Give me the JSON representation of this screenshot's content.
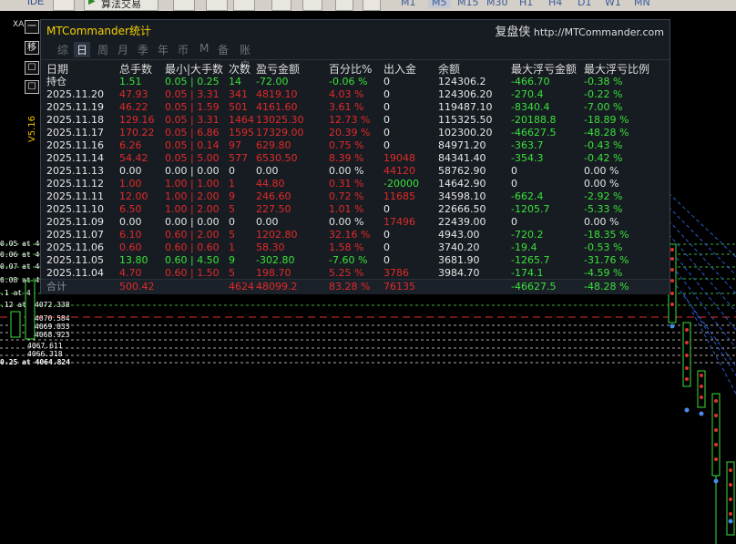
{
  "toolbar": {
    "idle_label": "IDE",
    "algo_label": "算法交易",
    "timeframes": [
      "M1",
      "M5",
      "M15",
      "M30",
      "H1",
      "H4",
      "D1",
      "W1",
      "MN"
    ],
    "active_timeframe": "M5"
  },
  "chart": {
    "symbol": "XA",
    "version": "V5.16",
    "side_buttons": [
      "一",
      "移",
      "☐",
      "☐"
    ],
    "price_labels": [
      {
        "text": "0.05 at 408"
      },
      {
        "text": "0.06 at 407"
      },
      {
        "text": "0.07 at 407"
      },
      {
        "text": "0.08 at 407"
      },
      {
        "text": ".1 at 4 "
      },
      {
        "text": ".12 at "
      },
      {
        "text": "4072.338"
      },
      {
        "text": "4070.584"
      },
      {
        "text": "4069.833"
      },
      {
        "text": "4068.923"
      },
      {
        "text": "4067.611"
      },
      {
        "text": "4066.318"
      },
      {
        "text": "0.25 at 4064.824"
      }
    ]
  },
  "panel": {
    "title": "MTCommander统计",
    "brand": "复盘侠",
    "brand_url": "http://MTCommander.com",
    "tabs": [
      "综",
      "日",
      "周",
      "月",
      "季",
      "年",
      "币",
      "M",
      "备",
      "账户"
    ],
    "active_tab": "日",
    "headers": [
      "日期",
      "总手数",
      "最小|大手数",
      "次数",
      "盈亏金额",
      "百分比%",
      "出入金",
      "余额",
      "最大浮亏金额",
      "最大浮亏比例"
    ],
    "holding": {
      "date": "持仓",
      "lots": "1.51",
      "minmax": "0.05 | 0.25",
      "count": "14",
      "pnl": "-72.00",
      "pct": "-0.06 %",
      "io": "0",
      "balance": "124306.2",
      "maxdd": "-466.70",
      "maxddpct": "-0.38 %"
    },
    "rows": [
      {
        "date": "2025.11.20",
        "lots": "47.93",
        "minmax": "0.05 | 3.31",
        "count": "341",
        "pnl": "4819.10",
        "pct": "4.03 %",
        "io": "0",
        "balance": "124306.20",
        "maxdd": "-270.4",
        "maxddpct": "-0.22 %",
        "color": "red"
      },
      {
        "date": "2025.11.19",
        "lots": "46.22",
        "minmax": "0.05 | 1.59",
        "count": "501",
        "pnl": "4161.60",
        "pct": "3.61 %",
        "io": "0",
        "balance": "119487.10",
        "maxdd": "-8340.4",
        "maxddpct": "-7.00 %",
        "color": "red"
      },
      {
        "date": "2025.11.18",
        "lots": "129.16",
        "minmax": "0.05 | 3.31",
        "count": "1464",
        "pnl": "13025.30",
        "pct": "12.73 %",
        "io": "0",
        "balance": "115325.50",
        "maxdd": "-20188.8",
        "maxddpct": "-18.89 %",
        "color": "red"
      },
      {
        "date": "2025.11.17",
        "lots": "170.22",
        "minmax": "0.05 | 6.86",
        "count": "1595",
        "pnl": "17329.00",
        "pct": "20.39 %",
        "io": "0",
        "balance": "102300.20",
        "maxdd": "-46627.5",
        "maxddpct": "-48.28 %",
        "color": "red"
      },
      {
        "date": "2025.11.16",
        "lots": "6.26",
        "minmax": "0.05 | 0.14",
        "count": "97",
        "pnl": "629.80",
        "pct": "0.75 %",
        "io": "0",
        "balance": "84971.20",
        "maxdd": "-363.7",
        "maxddpct": "-0.43 %",
        "color": "red"
      },
      {
        "date": "2025.11.14",
        "lots": "54.42",
        "minmax": "0.05 | 5.00",
        "count": "577",
        "pnl": "6530.50",
        "pct": "8.39 %",
        "io": "19048",
        "balance": "84341.40",
        "maxdd": "-354.3",
        "maxddpct": "-0.42 %",
        "color": "red"
      },
      {
        "date": "2025.11.13",
        "lots": "0.00",
        "minmax": "0.00 | 0.00",
        "count": "0",
        "pnl": "0.00",
        "pct": "0.00 %",
        "io": "44120",
        "balance": "58762.90",
        "maxdd": "0",
        "maxddpct": "0.00 %",
        "color": "white"
      },
      {
        "date": "2025.11.12",
        "lots": "1.00",
        "minmax": "1.00 | 1.00",
        "count": "1",
        "pnl": "44.80",
        "pct": "0.31 %",
        "io": "-20000",
        "balance": "14642.90",
        "maxdd": "0",
        "maxddpct": "0.00 %",
        "color": "red"
      },
      {
        "date": "2025.11.11",
        "lots": "12.00",
        "minmax": "1.00 | 2.00",
        "count": "9",
        "pnl": "246.60",
        "pct": "0.72 %",
        "io": "11685",
        "balance": "34598.10",
        "maxdd": "-662.4",
        "maxddpct": "-2.92 %",
        "color": "red"
      },
      {
        "date": "2025.11.10",
        "lots": "6.50",
        "minmax": "1.00 | 2.00",
        "count": "5",
        "pnl": "227.50",
        "pct": "1.01 %",
        "io": "0",
        "balance": "22666.50",
        "maxdd": "-1205.7",
        "maxddpct": "-5.33 %",
        "color": "red"
      },
      {
        "date": "2025.11.09",
        "lots": "0.00",
        "minmax": "0.00 | 0.00",
        "count": "0",
        "pnl": "0.00",
        "pct": "0.00 %",
        "io": "17496",
        "balance": "22439.00",
        "maxdd": "0",
        "maxddpct": "0.00 %",
        "color": "white"
      },
      {
        "date": "2025.11.07",
        "lots": "6.10",
        "minmax": "0.60 | 2.00",
        "count": "5",
        "pnl": "1202.80",
        "pct": "32.16 %",
        "io": "0",
        "balance": "4943.00",
        "maxdd": "-720.2",
        "maxddpct": "-18.35 %",
        "color": "red"
      },
      {
        "date": "2025.11.06",
        "lots": "0.60",
        "minmax": "0.60 | 0.60",
        "count": "1",
        "pnl": "58.30",
        "pct": "1.58 %",
        "io": "0",
        "balance": "3740.20",
        "maxdd": "-19.4",
        "maxddpct": "-0.53 %",
        "color": "red"
      },
      {
        "date": "2025.11.05",
        "lots": "13.80",
        "minmax": "0.60 | 4.50",
        "count": "9",
        "pnl": "-302.80",
        "pct": "-7.60 %",
        "io": "0",
        "balance": "3681.90",
        "maxdd": "-1265.7",
        "maxddpct": "-31.76 %",
        "color": "green"
      },
      {
        "date": "2025.11.04",
        "lots": "4.70",
        "minmax": "0.60 | 1.50",
        "count": "5",
        "pnl": "198.70",
        "pct": "5.25 %",
        "io": "3786",
        "balance": "3984.70",
        "maxdd": "-174.1",
        "maxddpct": "-4.59 %",
        "color": "red"
      }
    ],
    "total": {
      "date": "合计",
      "lots": "500.42",
      "minmax": "",
      "count": "4624",
      "pnl": "48099.2",
      "pct": "83.28 %",
      "io": "76135",
      "balance": "",
      "maxdd": "-46627.5",
      "maxddpct": "-48.28 %"
    },
    "colors": {
      "profit": "#e02a2a",
      "loss": "#3ae03a",
      "title": "#f5d000"
    }
  }
}
